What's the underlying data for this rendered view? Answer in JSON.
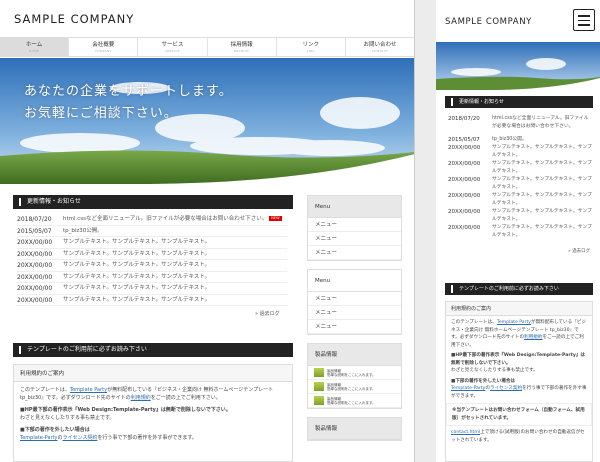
{
  "company": "SAMPLE COMPANY",
  "nav": [
    {
      "jp": "ホーム",
      "en": "HOME",
      "active": true
    },
    {
      "jp": "会社概要",
      "en": "COMPANY"
    },
    {
      "jp": "サービス",
      "en": "SERVICE"
    },
    {
      "jp": "採用情報",
      "en": "RECRUIT"
    },
    {
      "jp": "リンク",
      "en": "LINK"
    },
    {
      "jp": "お問い合わせ",
      "en": "CONTACT"
    }
  ],
  "hero": {
    "line1": "あなたの企業をサポートします。",
    "line2": "お気軽にご相談下さい。"
  },
  "news": {
    "heading": "更新情報・お知らせ",
    "new_badge": "NEW",
    "items": [
      {
        "date": "2018/07/20",
        "text": "html.cssなど全面リニューアル。旧ファイルが必要な場合はお問い合わせ下さい。"
      },
      {
        "date": "2015/05/07",
        "text": "tp_biz30公開。"
      },
      {
        "date": "20XX/00/00",
        "text": "サンプルテキスト。サンプルテキスト。サンプルテキスト。"
      },
      {
        "date": "20XX/00/00",
        "text": "サンプルテキスト。サンプルテキスト。サンプルテキスト。"
      },
      {
        "date": "20XX/00/00",
        "text": "サンプルテキスト。サンプルテキスト。サンプルテキスト。"
      },
      {
        "date": "20XX/00/00",
        "text": "サンプルテキスト。サンプルテキスト。サンプルテキスト。"
      },
      {
        "date": "20XX/00/00",
        "text": "サンプルテキスト。サンプルテキスト。サンプルテキスト。"
      },
      {
        "date": "20XX/00/00",
        "text": "サンプルテキスト。サンプルテキスト。サンプルテキスト。"
      }
    ],
    "past_link": "» 過去ログ"
  },
  "template": {
    "heading": "テンプレートのご利用前に必ずお読み下さい",
    "box_heading": "利用規約のご案内",
    "p1_a": "このテンプレートは、",
    "p1_link": "Template Party",
    "p1_b": "が無料配布している『ビジネス・企業向け 無料ホームページテンプレート tp_biz30』です。必ずダウンロード先のサイトの",
    "p1_link2": "利用規約",
    "p1_c": "をご一読の上でご利用下さい。",
    "p2": "■HP最下部の著作表示『Web Design:Template-Party』は無断で削除しないで下さい。",
    "p3": "わざと見えなくしたりする事も禁止です。",
    "p4": "■下部の著作を外したい場合は",
    "p5_link": "Template-Party",
    "p5_a": "の",
    "p5_link2": "ライセンス契約",
    "p5_b": "を行う事で下部の著作を外す事ができます。",
    "m_p6": "※当テンプレートはお問い合わせフォーム（自動フォーム、試用版）がセットされています。",
    "m_p7_link": "contact.html",
    "m_p7": "上で頂ける(試用版)のお問い合わせの自動返信がセットされています。"
  },
  "side": {
    "menu1_title": "Menu",
    "menu1_items": [
      "メニュー",
      "メニュー",
      "メニュー"
    ],
    "menu2_title": "Menu",
    "menu2_items": [
      "メニュー",
      "メニュー",
      "メニュー"
    ],
    "products_title": "製品情報",
    "products": [
      {
        "name": "製品情報",
        "desc": "簡単な説明をここに入れます。"
      },
      {
        "name": "製品情報",
        "desc": "簡単な説明をここに入れます。"
      },
      {
        "name": "製品情報",
        "desc": "簡単な説明をここに入れます。"
      }
    ],
    "products2_title": "製品情報"
  },
  "mobile_news": [
    {
      "date": "2018/07/20",
      "text": "html.cssなど全面リニューアル。旧ファイルが必要な場合はお問い合わせ下さい。"
    },
    {
      "date": "2015/05/07",
      "text": "tp_biz30公開。"
    },
    {
      "date": "20XX/00/00",
      "text": "サンプルテキスト。サンプルテキスト。サンプルテキスト。"
    },
    {
      "date": "20XX/00/00",
      "text": "サンプルテキスト。サンプルテキスト。サンプルテキスト。"
    },
    {
      "date": "20XX/00/00",
      "text": "サンプルテキスト。サンプルテキスト。サンプルテキスト。"
    },
    {
      "date": "20XX/00/00",
      "text": "サンプルテキスト。サンプルテキスト。サンプルテキスト。"
    },
    {
      "date": "20XX/00/00",
      "text": "サンプルテキスト。サンプルテキスト。サンプルテキスト。"
    },
    {
      "date": "20XX/00/00",
      "text": "サンプルテキスト。サンプルテキスト。サンプルテキスト。"
    }
  ],
  "colors": {
    "header_bar": "#222222",
    "accent_red": "#dd0000",
    "link_blue": "#2a6db0",
    "sky_top": "#2e6fb8",
    "grass": "#5d8d35"
  }
}
